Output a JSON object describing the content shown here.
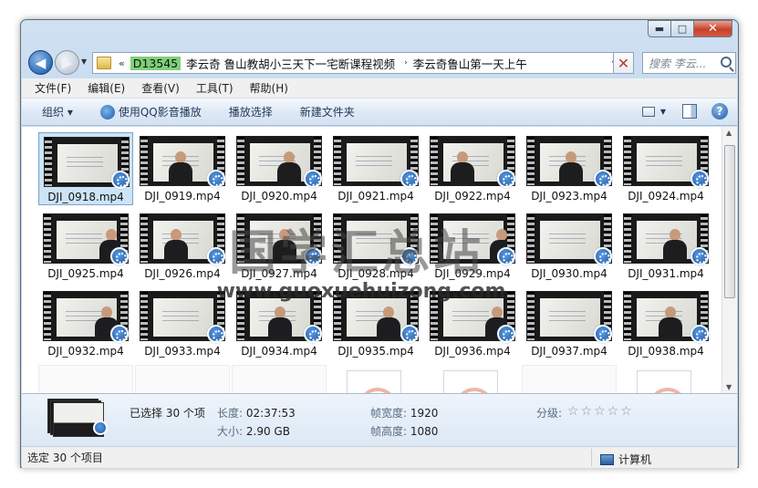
{
  "window": {
    "caption": {
      "minimize_icon": "minimize-icon",
      "maximize_icon": "maximize-icon",
      "close_icon": "close-icon"
    }
  },
  "address": {
    "overflow": "«",
    "crumbs": [
      "D13545",
      "李云奇 鲁山教胡小三天下一宅断课程视频",
      "李云奇鲁山第一天上午"
    ],
    "separator": "›"
  },
  "search": {
    "placeholder": "搜索 李云..."
  },
  "menu": [
    "文件(F)",
    "编辑(E)",
    "查看(V)",
    "工具(T)",
    "帮助(H)"
  ],
  "toolbar": {
    "organize": "组织 ▾",
    "play_qq": "使用QQ影音播放",
    "play_selection": "播放选择",
    "new_folder": "新建文件夹"
  },
  "files": [
    "DJI_0918.mp4",
    "DJI_0919.mp4",
    "DJI_0920.mp4",
    "DJI_0921.mp4",
    "DJI_0922.mp4",
    "DJI_0923.mp4",
    "DJI_0924.mp4",
    "DJI_0925.mp4",
    "DJI_0926.mp4",
    "DJI_0927.mp4",
    "DJI_0928.mp4",
    "DJI_0929.mp4",
    "DJI_0930.mp4",
    "DJI_0931.mp4",
    "DJI_0932.mp4",
    "DJI_0933.mp4",
    "DJI_0934.mp4",
    "DJI_0935.mp4",
    "DJI_0936.mp4",
    "DJI_0937.mp4",
    "DJI_0938.mp4"
  ],
  "watermark": {
    "title": "国学汇总站",
    "url": "www.guoxuehuizong.com"
  },
  "details": {
    "selected": "已选择 30 个项",
    "duration_label": "长度:",
    "duration": "02:37:53",
    "size_label": "大小:",
    "size": "2.90 GB",
    "width_label": "帧宽度:",
    "width": "1920",
    "height_label": "帧高度:",
    "height": "1080",
    "rating_label": "分级:",
    "rating_stars": "☆☆☆☆☆"
  },
  "status": {
    "text": "选定 30 个项目",
    "location": "计算机"
  }
}
